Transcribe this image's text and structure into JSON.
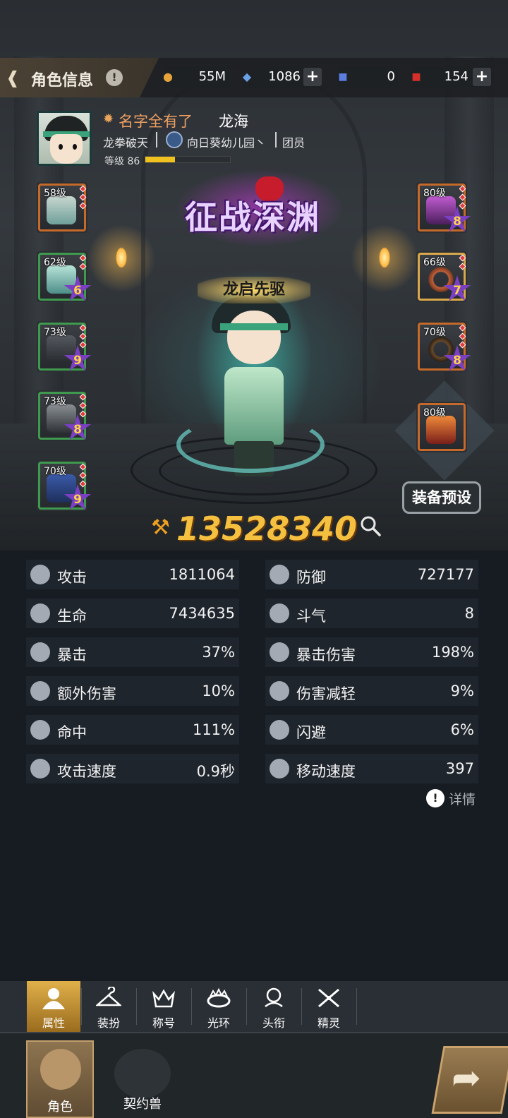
{
  "header": {
    "title": "角色信息",
    "info_symbol": "!",
    "currencies": [
      {
        "icon": "gold-coin-icon",
        "value": "55M"
      },
      {
        "icon": "crystal-icon",
        "value": "1086",
        "plus": "+"
      },
      {
        "icon": "card-icon",
        "value": "0"
      },
      {
        "icon": "gold-ticket-icon",
        "value": "154",
        "plus": "+"
      }
    ]
  },
  "character": {
    "name": "名字全有了",
    "title_name": "龙海",
    "class": "龙拳破天",
    "guild": "向日葵幼儿园丶",
    "role": "团员",
    "level_label": "等级 86",
    "level_progress": 0.35,
    "title_badge": "龙启先驱",
    "banner": "征战深渊",
    "power": "13528340"
  },
  "equipment_left": [
    {
      "level": "58级",
      "star": ""
    },
    {
      "level": "62级",
      "star": "6"
    },
    {
      "level": "73级",
      "star": "9"
    },
    {
      "level": "73级",
      "star": "8"
    },
    {
      "level": "70级",
      "star": "9"
    }
  ],
  "equipment_right": [
    {
      "level": "80级",
      "star": "8"
    },
    {
      "level": "66级",
      "star": "7"
    },
    {
      "level": "70级",
      "star": "8"
    },
    {
      "level": "80级",
      "star": ""
    }
  ],
  "preset_button": "装备预设",
  "stats": [
    {
      "label": "攻击",
      "value": "1811064"
    },
    {
      "label": "防御",
      "value": "727177"
    },
    {
      "label": "生命",
      "value": "7434635"
    },
    {
      "label": "斗气",
      "value": "8"
    },
    {
      "label": "暴击",
      "value": "37%"
    },
    {
      "label": "暴击伤害",
      "value": "198%"
    },
    {
      "label": "额外伤害",
      "value": "10%"
    },
    {
      "label": "伤害减轻",
      "value": "9%"
    },
    {
      "label": "命中",
      "value": "111%"
    },
    {
      "label": "闪避",
      "value": "6%"
    },
    {
      "label": "攻击速度",
      "value": "0.9秒"
    },
    {
      "label": "移动速度",
      "value": "397"
    }
  ],
  "details_link": "详情",
  "subtabs": [
    "属性",
    "装扮",
    "称号",
    "光环",
    "头衔",
    "精灵"
  ],
  "bottom_nav": [
    "角色",
    "契约兽"
  ],
  "colors": {
    "accent": "#f5c040",
    "name": "#f0a062",
    "tab_active": "#e0b04a"
  }
}
